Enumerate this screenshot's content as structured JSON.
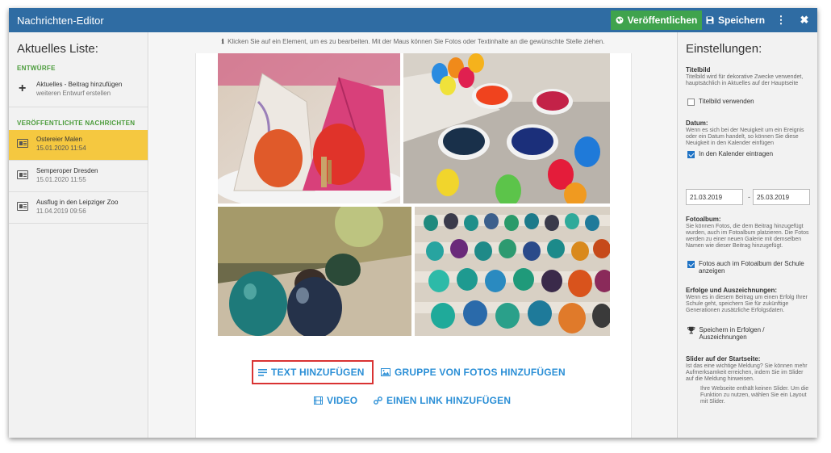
{
  "window": {
    "title": "Nachrichten-Editor"
  },
  "toolbar": {
    "publish_label": "Veröffentlichen",
    "save_label": "Speichern",
    "more_label": "⋮",
    "close_label": "✖"
  },
  "left": {
    "heading": "Aktuelles Liste:",
    "drafts_label": "ENTWÜRFE",
    "add_title": "Aktuelles - Beitrag hinzufügen",
    "add_sub": "weiteren Entwurf erstellen",
    "published_label": "VERÖFFENTLICHTE NACHRICHTEN",
    "items": [
      {
        "title": "Ostereier Malen",
        "date": "15.01.2020 11:54",
        "active": true
      },
      {
        "title": "Semperoper Dresden",
        "date": "15.01.2020 11:55",
        "active": false
      },
      {
        "title": "Ausflug in den Leipziger Zoo",
        "date": "11.04.2019 09:56",
        "active": false
      }
    ]
  },
  "center": {
    "hint": "Klicken Sie auf ein Element, um es zu bearbeiten. Mit der Maus können Sie Fotos oder Textinhalte an die gewünschte Stelle ziehen.",
    "add_text": "TEXT HINZUFÜGEN",
    "add_photos": "GRUPPE VON FOTOS HINZUFÜGEN",
    "add_video": "VIDEO",
    "add_link": "EINEN LINK HINZUFÜGEN"
  },
  "right": {
    "heading": "Einstellungen:",
    "cover": {
      "title": "Titelbild",
      "desc": "Titelbild wird für dekorative Zwecke verwendet, hauptsächlich in Aktuelles auf der Hauptseite",
      "check": "Titelbild verwenden",
      "checked": false
    },
    "date": {
      "title": "Datum:",
      "desc": "Wenn es sich bei der Neuigkeit um ein Ereignis oder ein Datum handelt, so können Sie diese Neuigkeit in den Kalender einfügen",
      "check": "In den Kalender eintragen",
      "checked": true,
      "from": "21.03.2019",
      "to": "25.03.2019",
      "sep": "-"
    },
    "album": {
      "title": "Fotoalbum:",
      "desc": "Sie können Fotos, die dem Beitrag hinzugefügt wurden, auch im Fotoalbum platzieren. Die Fotos werden zu einer neuen Galerie mit demselben Namen wie dieser Beitrag hinzugefügt.",
      "check": "Fotos auch im Fotoalbum der Schule anzeigen",
      "checked": true
    },
    "awards": {
      "title": "Erfolge und Auszeichnungen:",
      "desc": "Wenn es in diesem Beitrag um einen Erfolg Ihrer Schule geht, speichern Sie für zukünftige Generationen zusätzliche Erfolgsdaten.",
      "action": "Speichern in Erfolgen / Auszeichnungen"
    },
    "slider": {
      "title": "Slider auf der Startseite:",
      "desc": "Ist das eine wichtige Meldung? Sie können mehr Aufmerksamkeit erreichen, indem Sie im Slider auf die Meldung hinweisen.",
      "note": "Ihre Webseite enthält keinen Slider. Um die Funktion zu nutzen, wählen Sie ein Layout mit Slider."
    }
  },
  "colors": {
    "titlebar": "#2f6ca3",
    "publish": "#3fa34d",
    "active_item": "#f5c840",
    "link": "#2b8fd6",
    "highlight": "#d93333",
    "section_green": "#4a9b3a"
  }
}
